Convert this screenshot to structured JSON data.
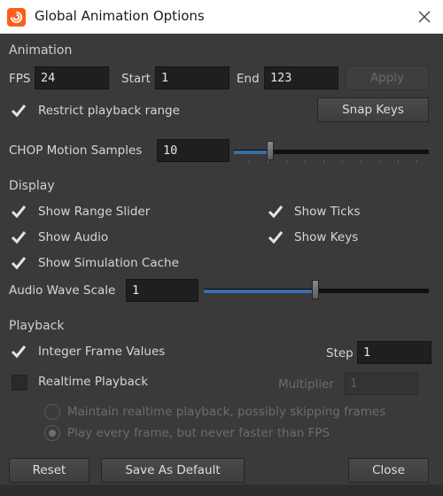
{
  "window": {
    "title": "Global Animation Options",
    "close_icon": "close-icon",
    "app_icon": "houdini-logo-icon",
    "brand_color": "#ff5e19"
  },
  "animation": {
    "section_label": "Animation",
    "fps_label": "FPS",
    "fps_value": "24",
    "start_label": "Start",
    "start_value": "1",
    "end_label": "End",
    "end_value": "123",
    "apply_label": "Apply",
    "restrict_label": "Restrict playback range",
    "restrict_checked": true,
    "snap_keys_label": "Snap Keys",
    "chop_label": "CHOP Motion Samples",
    "chop_value": "10",
    "chop_slider_fraction": 0.16
  },
  "display": {
    "section_label": "Display",
    "show_range_slider": "Show Range Slider",
    "show_ticks": "Show Ticks",
    "show_audio": "Show Audio",
    "show_keys": "Show Keys",
    "show_sim_cache": "Show Simulation Cache",
    "audio_wave_label": "Audio Wave Scale",
    "audio_wave_value": "1",
    "audio_wave_fraction": 0.5
  },
  "playback": {
    "section_label": "Playback",
    "integer_frames": "Integer Frame Values",
    "integer_checked": true,
    "step_label": "Step",
    "step_value": "1",
    "realtime": "Realtime Playback",
    "realtime_checked": false,
    "multiplier_label": "Multiplier",
    "multiplier_value": "1",
    "radio_maintain": "Maintain realtime playback, possibly skipping frames",
    "radio_every": "Play every frame, but never faster than FPS",
    "selected_radio": "radio_every"
  },
  "footer": {
    "reset": "Reset",
    "save_default": "Save As Default",
    "close": "Close"
  }
}
